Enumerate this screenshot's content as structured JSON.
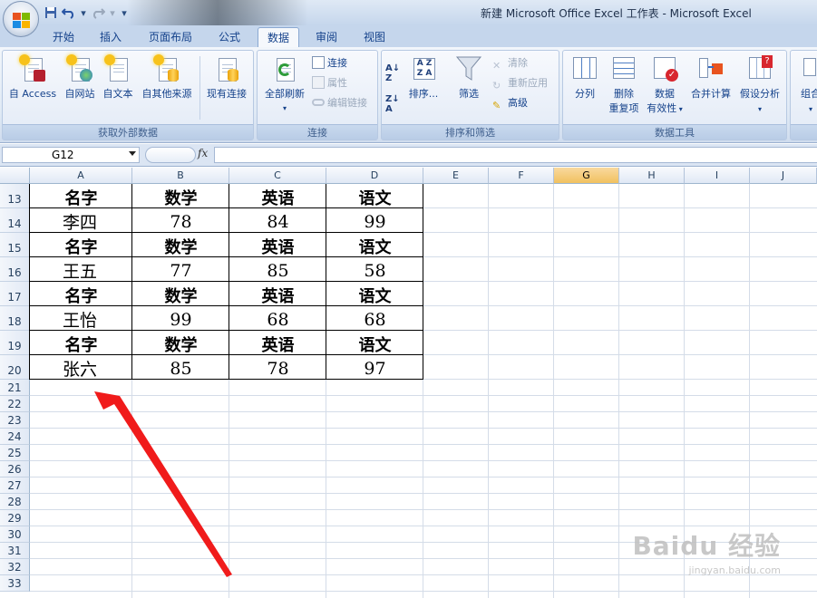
{
  "window": {
    "title": "新建 Microsoft Office Excel 工作表 - Microsoft Excel"
  },
  "tabs": [
    "开始",
    "插入",
    "页面布局",
    "公式",
    "数据",
    "审阅",
    "视图"
  ],
  "active_tab": "数据",
  "ribbon": {
    "groups": {
      "external": {
        "title": "获取外部数据",
        "buttons": [
          "自 Access",
          "自网站",
          "自文本",
          "自其他来源",
          "现有连接"
        ]
      },
      "connections": {
        "title": "连接",
        "refresh_all": "全部刷新",
        "small": [
          "连接",
          "属性",
          "编辑链接"
        ]
      },
      "sort_filter": {
        "title": "排序和筛选",
        "sort": "排序...",
        "filter": "筛选",
        "small": [
          "清除",
          "重新应用",
          "高级"
        ]
      },
      "data_tools": {
        "title": "数据工具",
        "split": "分列",
        "remove_dup_1": "删除",
        "remove_dup_2": "重复项",
        "validation_1": "数据",
        "validation_2": "有效性",
        "consolidate": "合并计算",
        "whatif": "假设分析"
      },
      "outline": {
        "label": "组合"
      }
    }
  },
  "formula_bar": {
    "name_box": "G12",
    "fx_label": "fx",
    "formula": ""
  },
  "sheet": {
    "columns": [
      "A",
      "B",
      "C",
      "D",
      "E",
      "F",
      "G",
      "H",
      "I",
      "J"
    ],
    "selected_column": "G",
    "row_numbers": [
      "13",
      "14",
      "15",
      "16",
      "17",
      "18",
      "19",
      "20",
      "21",
      "22",
      "23",
      "24",
      "25",
      "26",
      "27",
      "28",
      "29",
      "30",
      "31",
      "32",
      "33"
    ],
    "table_rows": [
      {
        "row": "13",
        "header": true,
        "cells": [
          "名字",
          "数学",
          "英语",
          "语文"
        ]
      },
      {
        "row": "14",
        "header": false,
        "cells": [
          "李四",
          "78",
          "84",
          "99"
        ]
      },
      {
        "row": "15",
        "header": true,
        "cells": [
          "名字",
          "数学",
          "英语",
          "语文"
        ]
      },
      {
        "row": "16",
        "header": false,
        "cells": [
          "王五",
          "77",
          "85",
          "58"
        ]
      },
      {
        "row": "17",
        "header": true,
        "cells": [
          "名字",
          "数学",
          "英语",
          "语文"
        ]
      },
      {
        "row": "18",
        "header": false,
        "cells": [
          "王怡",
          "99",
          "68",
          "68"
        ]
      },
      {
        "row": "19",
        "header": true,
        "cells": [
          "名字",
          "数学",
          "英语",
          "语文"
        ]
      },
      {
        "row": "20",
        "header": false,
        "cells": [
          "张六",
          "85",
          "78",
          "97"
        ]
      }
    ]
  },
  "annotation": {
    "arrow_color": "#f01b1b"
  },
  "watermark": {
    "brand": "Baidu 经验",
    "url": "jingyan.baidu.com"
  }
}
